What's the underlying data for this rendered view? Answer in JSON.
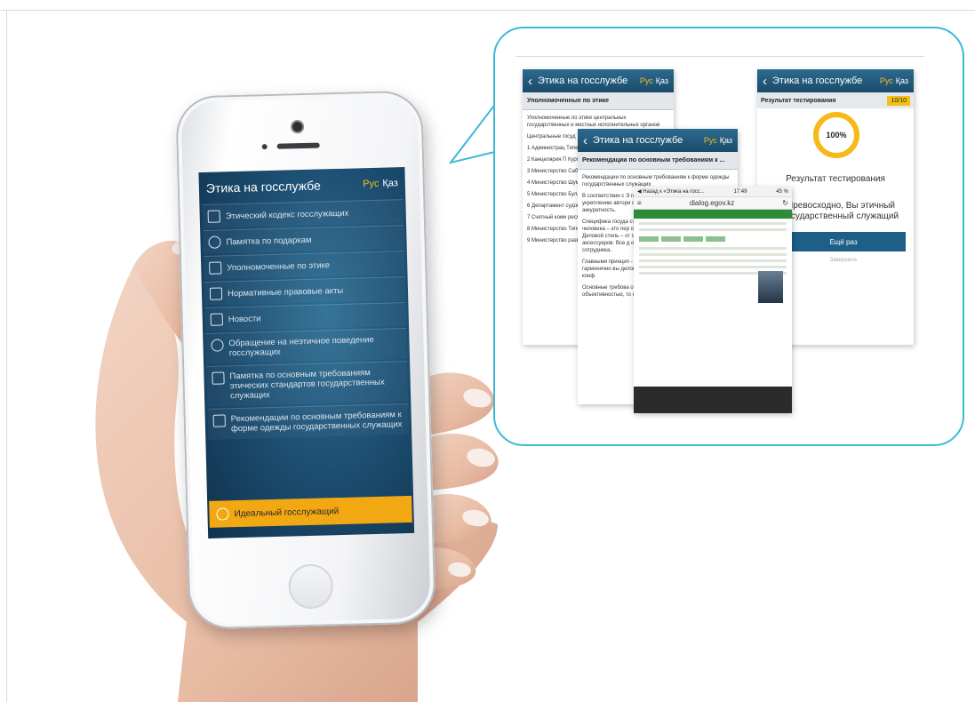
{
  "phone_app": {
    "title": "Этика на госслужбе",
    "lang_ru": "Рус",
    "lang_kz": "Қаз",
    "menu": [
      {
        "label": "Этический кодекс госслужащих",
        "icon": "book-icon"
      },
      {
        "label": "Памятка по подаркам",
        "icon": "users-icon"
      },
      {
        "label": "Уполномоченные по этике",
        "icon": "document-icon"
      },
      {
        "label": "Нормативные правовые акты",
        "icon": "newspaper-icon"
      },
      {
        "label": "Новости",
        "icon": "calendar-icon"
      },
      {
        "label": "Обращение на неэтичное поведение госслужащих",
        "icon": "people-icon"
      },
      {
        "label": "Памятка по основным требованиям этических стандартов государственных служащих",
        "icon": "book-icon"
      },
      {
        "label": "Рекомендации по основным требованиям к форме одежды государственных служащих",
        "icon": "megaphone-icon"
      }
    ],
    "ideal_button": "Идеальный госслужащий"
  },
  "screens": {
    "officers": {
      "title": "Этика на госслужбе",
      "lang_ru": "Рус",
      "lang_kz": "Қаз",
      "subtitle": "Уполномоченные по этике",
      "body": [
        "Уполномоченные по этике центральных государственных и местных исполнительных органов",
        "Центральные госуд",
        "1   Администрац Типеубеков, тел: 74",
        "2   Канцелярия П Курметжанович Ай",
        "3   Министерство Сабитович",
        "4   Министерство Шумшабайулы Сар",
        "5   Министерство Булатович Муратбе",
        "6   Департамент судов при Верховн Рахымбекова, тел:",
        "7   Счетный коми республиканского б Байжанов, тел: 70-",
        "8   Министерство Типеуовн Даржиб",
        "9   Министерство развития - Владим 45"
      ]
    },
    "dress": {
      "title": "Этика на госслужбе",
      "lang_ru": "Рус",
      "lang_kz": "Қаз",
      "subtitle": "Рекомендации по основным требованиям к ...",
      "body": [
        "Рекомендации по основным требованиям к форме одежды государственных служащих",
        "В соответствии с Э государственного с служебных обязанн укреплению автори соответствовать об который отличают аккуратность.",
        "Специфика госуда строгие требовани государственных сл человека – это пер общества его внеш свидетельствующи Деловой стиль – от строгостью и сдерж выбора ткани – вид аксессуаров. Все д определенным – ф должна отвечать сотрудника.",
        "Главными принцип - минимализм; - умение не выд - гармонично вы деловая обстановка – оовер переговоры в конф",
        "Основные требова опрятность, удобст внешнего вида. Од объективностью, то ес"
      ]
    },
    "result": {
      "title": "Этика на госслужбе",
      "lang_ru": "Рус",
      "lang_kz": "Қаз",
      "bar_label": "Результат тестирования",
      "count": "10/10",
      "percent": "100%",
      "result_title": "Результат тестирования",
      "message": "Превосходно, Вы этичный государственный служащий",
      "again": "Ещё раз",
      "finish": "Завершить"
    },
    "browser": {
      "status_left": "◀ Назад к «Этика на госс...",
      "status_time": "17:49",
      "status_right": "45 %",
      "url": "dialog.egov.kz"
    }
  },
  "colors": {
    "accent": "#f2a813",
    "callout_border": "#3cb9d8",
    "header_blue": "#1c4a6a"
  }
}
